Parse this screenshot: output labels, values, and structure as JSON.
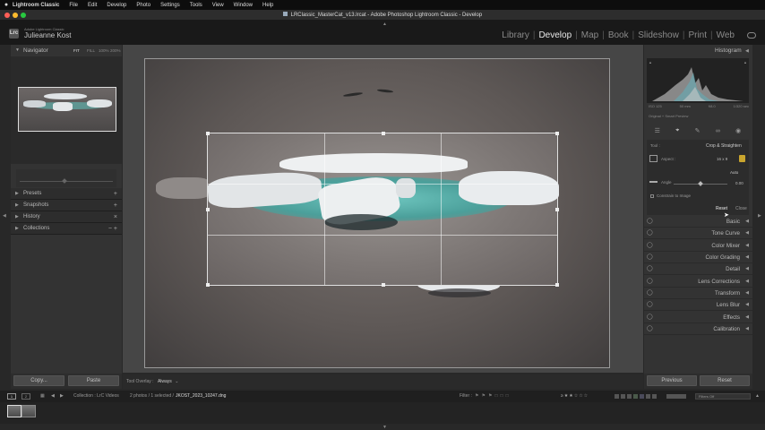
{
  "menubar": {
    "apple": "",
    "app": "Lightroom Classic",
    "items": [
      "File",
      "Edit",
      "Develop",
      "Photo",
      "Settings",
      "Tools",
      "View",
      "Window",
      "Help"
    ]
  },
  "window": {
    "title": "LRClassic_MasterCat_v13.lrcat - Adobe Photoshop Lightroom Classic - Develop"
  },
  "identity": {
    "sub": "Adobe Lightroom Classic",
    "name": "Julieanne Kost",
    "logo": "Lrc"
  },
  "modules": [
    "Library",
    "Develop",
    "Map",
    "Book",
    "Slideshow",
    "Print",
    "Web"
  ],
  "active_module": "Develop",
  "left": {
    "navigator": {
      "title": "Navigator",
      "zoom": [
        "FIT",
        "FILL",
        "100%",
        "200%"
      ]
    },
    "sections": [
      {
        "label": "Presets",
        "action": "+"
      },
      {
        "label": "Snapshots",
        "action": "+"
      },
      {
        "label": "History",
        "action": "×"
      },
      {
        "label": "Collections",
        "action": "− +"
      }
    ],
    "copy": "Copy...",
    "paste": "Paste"
  },
  "toolbar": {
    "label": "Tool Overlay :",
    "value": "Always"
  },
  "right": {
    "histogram": {
      "title": "Histogram",
      "readouts": [
        "ISO 125",
        "50 mm",
        "f/8.0",
        "1/320 sec"
      ],
      "preview": "Original + Smart Preview"
    },
    "crop": {
      "tool_label": "Tool :",
      "tool_name": "Crop & Straighten",
      "aspect_label": "Aspect :",
      "aspect_value": "16 x 9",
      "auto": "Auto",
      "angle_label": "Angle",
      "angle_value": "0.00",
      "constrain": "Constrain to Image",
      "reset": "Reset",
      "close": "Close"
    },
    "panels": [
      "Basic",
      "Tone Curve",
      "Color Mixer",
      "Color Grading",
      "Detail",
      "Lens Corrections",
      "Transform",
      "Lens Blur",
      "Effects",
      "Calibration"
    ],
    "previous": "Previous",
    "reset": "Reset"
  },
  "filmstrip": {
    "pages": [
      "1",
      "2"
    ],
    "source": "Collection : LrC Videos",
    "count": "2 photos / 1 selected /",
    "file": "JKOST_2023_10247.dng",
    "filter_label": "Filter :",
    "filter_value": "Filters Off"
  }
}
